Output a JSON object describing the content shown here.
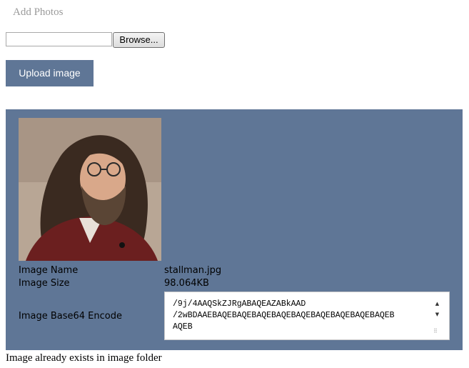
{
  "page": {
    "title": "Add Photos"
  },
  "upload_form": {
    "file_path_value": "",
    "browse_label": "Browse...",
    "upload_label": "Upload image"
  },
  "result": {
    "image_alt": "stallman",
    "labels": {
      "name": "Image Name",
      "size": "Image Size",
      "base64": "Image Base64 Encode"
    },
    "values": {
      "name": "stallman.jpg",
      "size": "98.064KB",
      "base64": "/9j/4AAQSkZJRgABAQEAZABkAAD\n/2wBDAAEBAQEBAQEBAQEBAQEBAQEBAQEBAQEBAQEBAQEB\nAQEB"
    }
  },
  "status": {
    "message": "Image already exists in image folder"
  },
  "colors": {
    "accent": "#5f7696",
    "title_gray": "#9a9a9a"
  },
  "icons": {
    "scroll_up": "triangle-up",
    "scroll_down": "triangle-down",
    "resize": "resize-grip"
  }
}
